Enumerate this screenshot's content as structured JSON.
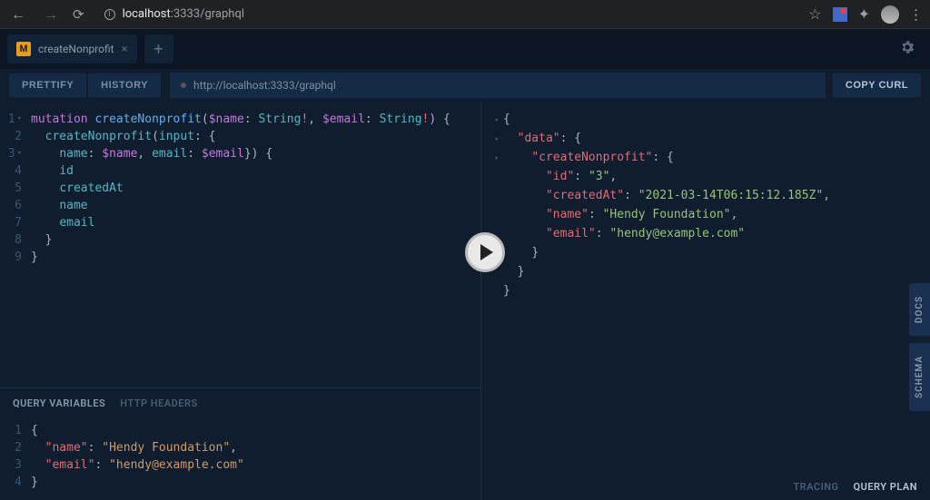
{
  "browser": {
    "url_scheme": "",
    "url_info": "ⓘ",
    "url_host": "localhost",
    "url_port": ":3333",
    "url_path": "/graphql"
  },
  "tabs": {
    "active_badge": "M",
    "active_label": "createNonprofit"
  },
  "toolbar": {
    "prettify": "PRETTIFY",
    "history": "HISTORY",
    "endpoint": "http://localhost:3333/graphql",
    "copy_curl": "COPY CURL"
  },
  "query": {
    "line1_kw": "mutation",
    "line1_name": "createNonprofit",
    "line1_var1": "$name",
    "line1_type": "String",
    "line1_var2": "$email",
    "line2_field": "createNonprofit",
    "line2_arg": "input",
    "line3_k1": "name",
    "line3_v1": "$name",
    "line3_k2": "email",
    "line3_v2": "$email",
    "line4": "id",
    "line5": "createdAt",
    "line6": "name",
    "line7": "email"
  },
  "vars": {
    "tab_vars": "QUERY VARIABLES",
    "tab_headers": "HTTP HEADERS",
    "k1": "\"name\"",
    "v1": "\"Hendy Foundation\"",
    "k2": "\"email\"",
    "v2": "\"hendy@example.com\""
  },
  "response": {
    "data_key": "\"data\"",
    "create_key": "\"createNonprofit\"",
    "id_k": "\"id\"",
    "id_v": "\"3\"",
    "ca_k": "\"createdAt\"",
    "ca_v": "\"2021-03-14T06:15:12.185Z\"",
    "name_k": "\"name\"",
    "name_v": "\"Hendy Foundation\"",
    "email_k": "\"email\"",
    "email_v": "\"hendy@example.com\""
  },
  "sidebar": {
    "docs": "DOCS",
    "schema": "SCHEMA"
  },
  "footer": {
    "tracing": "TRACING",
    "query_plan": "QUERY PLAN"
  }
}
